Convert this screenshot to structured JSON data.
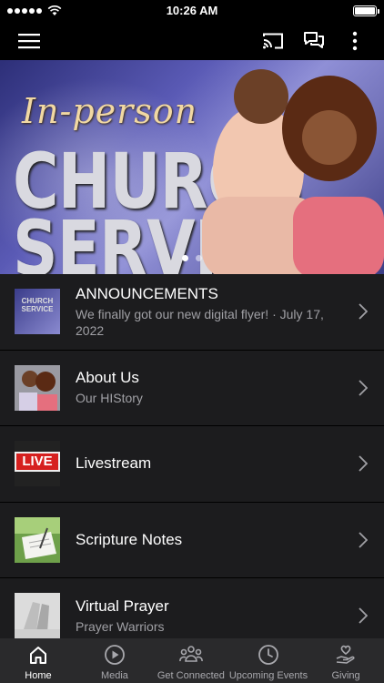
{
  "status_bar": {
    "time": "10:26 AM"
  },
  "app_bar": {
    "menu_icon": "hamburger-menu-icon",
    "cast_icon": "cast-icon",
    "chat_icon": "chat-bubbles-icon",
    "more_icon": "more-vertical-icon"
  },
  "hero": {
    "script_text": "In-person",
    "big_text_1": "CHURCH",
    "big_text_2": "SERVICE",
    "slides_total": 2,
    "active_slide": 1
  },
  "list": {
    "items": [
      {
        "title": "ANNOUNCEMENTS",
        "subtitle": "We finally got our new digital flyer! · July 17, 2022",
        "thumb_icon": "flyer-thumbnail",
        "thumb_text_1": "CHURCH",
        "thumb_text_2": "SERVICE"
      },
      {
        "title": "About Us",
        "subtitle": "Our HIStory",
        "thumb_icon": "couple-photo-thumbnail"
      },
      {
        "title": "Livestream",
        "subtitle": "",
        "thumb_icon": "live-sign-thumbnail",
        "thumb_text": "LIVE"
      },
      {
        "title": "Scripture Notes",
        "subtitle": "",
        "thumb_icon": "writing-notes-thumbnail"
      },
      {
        "title": "Virtual Prayer",
        "subtitle": "Prayer Warriors",
        "thumb_icon": "praying-hands-thumbnail"
      }
    ]
  },
  "tab_bar": {
    "tabs": [
      {
        "label": "Home",
        "icon": "home-icon",
        "active": true
      },
      {
        "label": "Media",
        "icon": "play-circle-icon",
        "active": false
      },
      {
        "label": "Get Connected",
        "icon": "group-icon",
        "active": false
      },
      {
        "label": "Upcoming Events",
        "icon": "clock-icon",
        "active": false
      },
      {
        "label": "Giving",
        "icon": "giving-hand-heart-icon",
        "active": false
      }
    ]
  },
  "colors": {
    "background": "#000000",
    "list_background": "#1c1c1e",
    "tab_bar_background": "#2a2a2c",
    "subtitle_text": "#a0a0a5",
    "live_red": "#d6201f"
  }
}
